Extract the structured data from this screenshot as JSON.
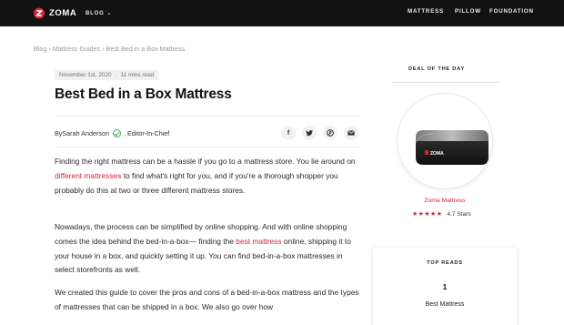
{
  "brand": {
    "name": "ZOMA",
    "accent": "#d6243a"
  },
  "nav": {
    "blog_label": "BLOG",
    "items": [
      {
        "label": "MATTRESS"
      },
      {
        "label": "PILLOW"
      },
      {
        "label": "FOUNDATION"
      }
    ]
  },
  "breadcrumb": {
    "items": [
      "Blog",
      "Mattress Guides",
      "Best Bed in a Box Mattress"
    ],
    "separator": "›"
  },
  "article": {
    "date": "November 1st, 2020",
    "separator": "·",
    "read_time": "11 mins read",
    "title": "Best Bed in a Box Mattress",
    "by_prefix": "By ",
    "author": "Sarah Anderson",
    "role": ", Editor-In-Chief",
    "share_icons": [
      "facebook-icon",
      "twitter-icon",
      "pinterest-icon",
      "email-icon"
    ],
    "p1": {
      "a": "Finding the right mattress can be a hassle if you go to a mattress store. You lie around on ",
      "link": "different mattresses",
      "b": " to find what's right for you, and if you're a thorough shopper you probably do this at two or three different mattress stores."
    },
    "p2": {
      "a": "Nowadays, the process can be simplified by online shopping. And with online shopping comes the idea behind the bed-in-a-box— finding the ",
      "link": "best mattress",
      "b": " online, shipping it to your house in a box, and quickly setting it up. You can find bed-in-a-box mattresses in select storefronts as well."
    },
    "p3": "We created this guide to cover the pros and cons of a bed-in-a-box mattress and the types of mattresses that can be shipped in a box. We also go over how"
  },
  "sidebar": {
    "deal_label": "DEAL OF THE DAY",
    "product_name": "Zoma Mattress",
    "product_logo": "ZOMA",
    "stars": "★★★★★",
    "rating": 4.7,
    "rating_text": "4.7 Stars",
    "top_reads_label": "TOP READS",
    "top_reads": [
      {
        "rank": "1",
        "title": "Best Mattress"
      }
    ]
  }
}
